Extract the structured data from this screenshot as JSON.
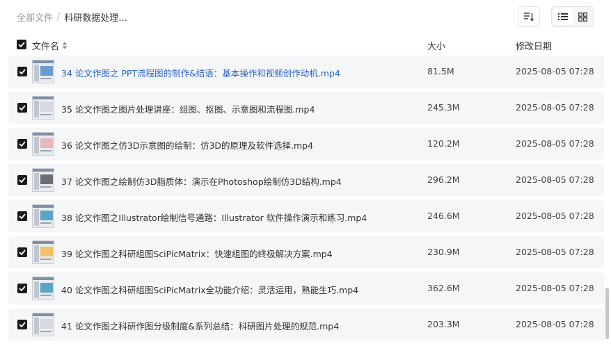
{
  "breadcrumb": {
    "root": "全部文件",
    "separator": "/",
    "current": "科研数据处理..."
  },
  "columns": {
    "name": "文件名",
    "size": "大小",
    "modified": "修改日期"
  },
  "files": [
    {
      "name": "34 论文作图之 PPT流程图的制作&结语：基本操作和视频创作动机.mp4",
      "size": "81.5M",
      "date": "2025-08-05 07:28",
      "thumb": "blue"
    },
    {
      "name": "35 论文作图之图片处理讲座：组图、抠图、示意图和流程图.mp4",
      "size": "245.3M",
      "date": "2025-08-05 07:28",
      "thumb": "gray"
    },
    {
      "name": "36 论文作图之仿3D示意图的绘制：仿3D的原理及软件选择.mp4",
      "size": "120.2M",
      "date": "2025-08-05 07:28",
      "thumb": "pink"
    },
    {
      "name": "37 论文作图之绘制仿3D脂质体：演示在Photoshop绘制仿3D结构.mp4",
      "size": "296.2M",
      "date": "2025-08-05 07:28",
      "thumb": "dark"
    },
    {
      "name": "38 论文作图之Illustrator绘制信号通路：Illustrator 软件操作演示和练习.mp4",
      "size": "246.6M",
      "date": "2025-08-05 07:28",
      "thumb": "teal"
    },
    {
      "name": "39 论文作图之科研组图SciPicMatrix：快速组图的终极解决方案.mp4",
      "size": "230.9M",
      "date": "2025-08-05 07:28",
      "thumb": "orange"
    },
    {
      "name": "40 论文作图之科研组图SciPicMatrix全功能介绍：灵活运用，熟能生巧.mp4",
      "size": "362.6M",
      "date": "2025-08-05 07:28",
      "thumb": "teal"
    },
    {
      "name": "41 论文作图之科研作图分级制度&系列总结：科研图片处理的规范.mp4",
      "size": "203.3M",
      "date": "2025-08-05 07:28",
      "thumb": "gray"
    }
  ],
  "icons": {
    "sort": "sort-icon",
    "list_view": "list-view-icon",
    "grid_view": "grid-view-icon",
    "checkbox": "checkmark-icon"
  },
  "colors": {
    "row_bg": "#f5f6f8",
    "link": "#2a63c8",
    "checkbox": "#1a1a1a"
  }
}
